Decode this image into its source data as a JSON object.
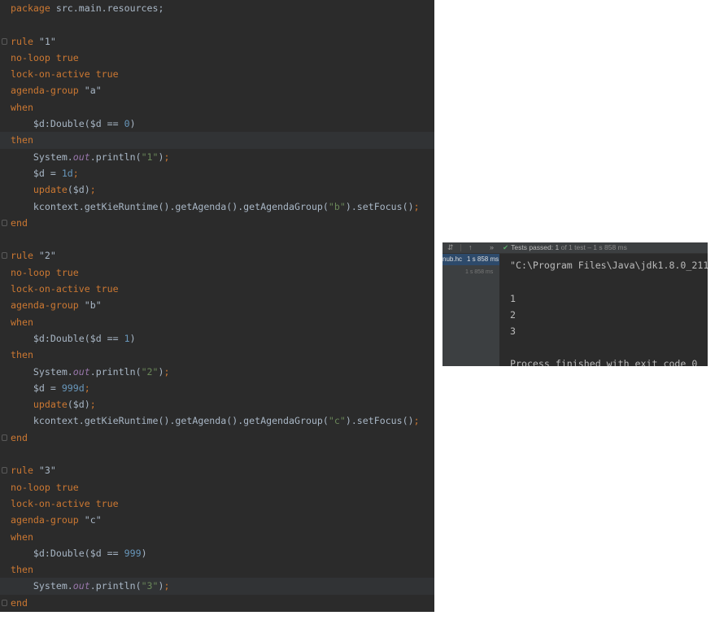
{
  "editor": {
    "lines": [
      {
        "tokens": [
          {
            "c": "kw",
            "t": "package "
          },
          {
            "c": "plain",
            "t": "src.main.resources;"
          }
        ]
      },
      {
        "tokens": []
      },
      {
        "tokens": [
          {
            "c": "kw",
            "t": "rule "
          },
          {
            "c": "plain",
            "t": "\"1\""
          }
        ],
        "fold": true
      },
      {
        "tokens": [
          {
            "c": "kw",
            "t": "no-loop "
          },
          {
            "c": "kw",
            "t": "true"
          }
        ]
      },
      {
        "tokens": [
          {
            "c": "kw",
            "t": "lock-on-active "
          },
          {
            "c": "kw",
            "t": "true"
          }
        ]
      },
      {
        "tokens": [
          {
            "c": "kw",
            "t": "agenda-group "
          },
          {
            "c": "plain",
            "t": "\"a\""
          }
        ]
      },
      {
        "tokens": [
          {
            "c": "kw",
            "t": "when"
          }
        ]
      },
      {
        "tokens": [
          {
            "c": "plain",
            "t": "    $d:Double($d == "
          },
          {
            "c": "num",
            "t": "0"
          },
          {
            "c": "plain",
            "t": ")"
          }
        ]
      },
      {
        "tokens": [
          {
            "c": "kw",
            "t": "then"
          }
        ],
        "hl": true
      },
      {
        "tokens": [
          {
            "c": "plain",
            "t": "    System."
          },
          {
            "c": "ital",
            "t": "out"
          },
          {
            "c": "plain",
            "t": ".println("
          },
          {
            "c": "str",
            "t": "\"1\""
          },
          {
            "c": "plain",
            "t": ")"
          },
          {
            "c": "kw",
            "t": ";"
          }
        ]
      },
      {
        "tokens": [
          {
            "c": "plain",
            "t": "    $d = "
          },
          {
            "c": "num",
            "t": "1d"
          },
          {
            "c": "kw",
            "t": ";"
          }
        ]
      },
      {
        "tokens": [
          {
            "c": "kw",
            "t": "    update"
          },
          {
            "c": "plain",
            "t": "($d)"
          },
          {
            "c": "kw",
            "t": ";"
          }
        ]
      },
      {
        "tokens": [
          {
            "c": "plain",
            "t": "    kcontext.getKieRuntime().getAgenda().getAgendaGroup("
          },
          {
            "c": "str",
            "t": "\"b\""
          },
          {
            "c": "plain",
            "t": ").setFocus()"
          },
          {
            "c": "kw",
            "t": ";"
          }
        ]
      },
      {
        "tokens": [
          {
            "c": "kw",
            "t": "end"
          }
        ],
        "fold": true
      },
      {
        "tokens": []
      },
      {
        "tokens": [
          {
            "c": "kw",
            "t": "rule "
          },
          {
            "c": "plain",
            "t": "\"2\""
          }
        ],
        "fold": true
      },
      {
        "tokens": [
          {
            "c": "kw",
            "t": "no-loop "
          },
          {
            "c": "kw",
            "t": "true"
          }
        ]
      },
      {
        "tokens": [
          {
            "c": "kw",
            "t": "lock-on-active "
          },
          {
            "c": "kw",
            "t": "true"
          }
        ]
      },
      {
        "tokens": [
          {
            "c": "kw",
            "t": "agenda-group "
          },
          {
            "c": "plain",
            "t": "\"b\""
          }
        ]
      },
      {
        "tokens": [
          {
            "c": "kw",
            "t": "when"
          }
        ]
      },
      {
        "tokens": [
          {
            "c": "plain",
            "t": "    $d:Double($d == "
          },
          {
            "c": "num",
            "t": "1"
          },
          {
            "c": "plain",
            "t": ")"
          }
        ]
      },
      {
        "tokens": [
          {
            "c": "kw",
            "t": "then"
          }
        ]
      },
      {
        "tokens": [
          {
            "c": "plain",
            "t": "    System."
          },
          {
            "c": "ital",
            "t": "out"
          },
          {
            "c": "plain",
            "t": ".println("
          },
          {
            "c": "str",
            "t": "\"2\""
          },
          {
            "c": "plain",
            "t": ")"
          },
          {
            "c": "kw",
            "t": ";"
          }
        ]
      },
      {
        "tokens": [
          {
            "c": "plain",
            "t": "    $d = "
          },
          {
            "c": "num",
            "t": "999d"
          },
          {
            "c": "kw",
            "t": ";"
          }
        ]
      },
      {
        "tokens": [
          {
            "c": "kw",
            "t": "    update"
          },
          {
            "c": "plain",
            "t": "($d)"
          },
          {
            "c": "kw",
            "t": ";"
          }
        ]
      },
      {
        "tokens": [
          {
            "c": "plain",
            "t": "    kcontext.getKieRuntime().getAgenda().getAgendaGroup("
          },
          {
            "c": "str",
            "t": "\"c\""
          },
          {
            "c": "plain",
            "t": ").setFocus()"
          },
          {
            "c": "kw",
            "t": ";"
          }
        ]
      },
      {
        "tokens": [
          {
            "c": "kw",
            "t": "end"
          }
        ],
        "fold": true
      },
      {
        "tokens": []
      },
      {
        "tokens": [
          {
            "c": "kw",
            "t": "rule "
          },
          {
            "c": "plain",
            "t": "\"3\""
          }
        ],
        "fold": true
      },
      {
        "tokens": [
          {
            "c": "kw",
            "t": "no-loop "
          },
          {
            "c": "kw",
            "t": "true"
          }
        ]
      },
      {
        "tokens": [
          {
            "c": "kw",
            "t": "lock-on-active "
          },
          {
            "c": "kw",
            "t": "true"
          }
        ]
      },
      {
        "tokens": [
          {
            "c": "kw",
            "t": "agenda-group "
          },
          {
            "c": "plain",
            "t": "\"c\""
          }
        ]
      },
      {
        "tokens": [
          {
            "c": "kw",
            "t": "when"
          }
        ]
      },
      {
        "tokens": [
          {
            "c": "plain",
            "t": "    $d:Double($d == "
          },
          {
            "c": "num",
            "t": "999"
          },
          {
            "c": "plain",
            "t": ")"
          }
        ]
      },
      {
        "tokens": [
          {
            "c": "kw",
            "t": "then"
          }
        ]
      },
      {
        "tokens": [
          {
            "c": "plain",
            "t": "    System."
          },
          {
            "c": "ital",
            "t": "out"
          },
          {
            "c": "plain",
            "t": ".println("
          },
          {
            "c": "str",
            "t": "\"3\""
          },
          {
            "c": "plain",
            "t": ")"
          },
          {
            "c": "kw",
            "t": ";"
          }
        ],
        "hl": true
      },
      {
        "tokens": [
          {
            "c": "kw",
            "t": "end"
          }
        ],
        "fold": true
      }
    ]
  },
  "run_panel": {
    "toolbar": {
      "sort_icon": "sort-icon",
      "up_icon": "arrow-up-icon",
      "more_icon": "double-chevron-icon",
      "status_label": "Tests passed:",
      "status_count": "1",
      "status_detail": "of 1 test – 1 s 858 ms"
    },
    "tree": {
      "row1_name": "nub.hc",
      "row1_time": "1 s 858 ms",
      "row2_time": "1 s 858 ms"
    },
    "console": {
      "command": "\"C:\\Program Files\\Java\\jdk1.8.0_211",
      "outputs": [
        "1",
        "2",
        "3"
      ],
      "finished": "Process finished with exit code 0"
    }
  }
}
